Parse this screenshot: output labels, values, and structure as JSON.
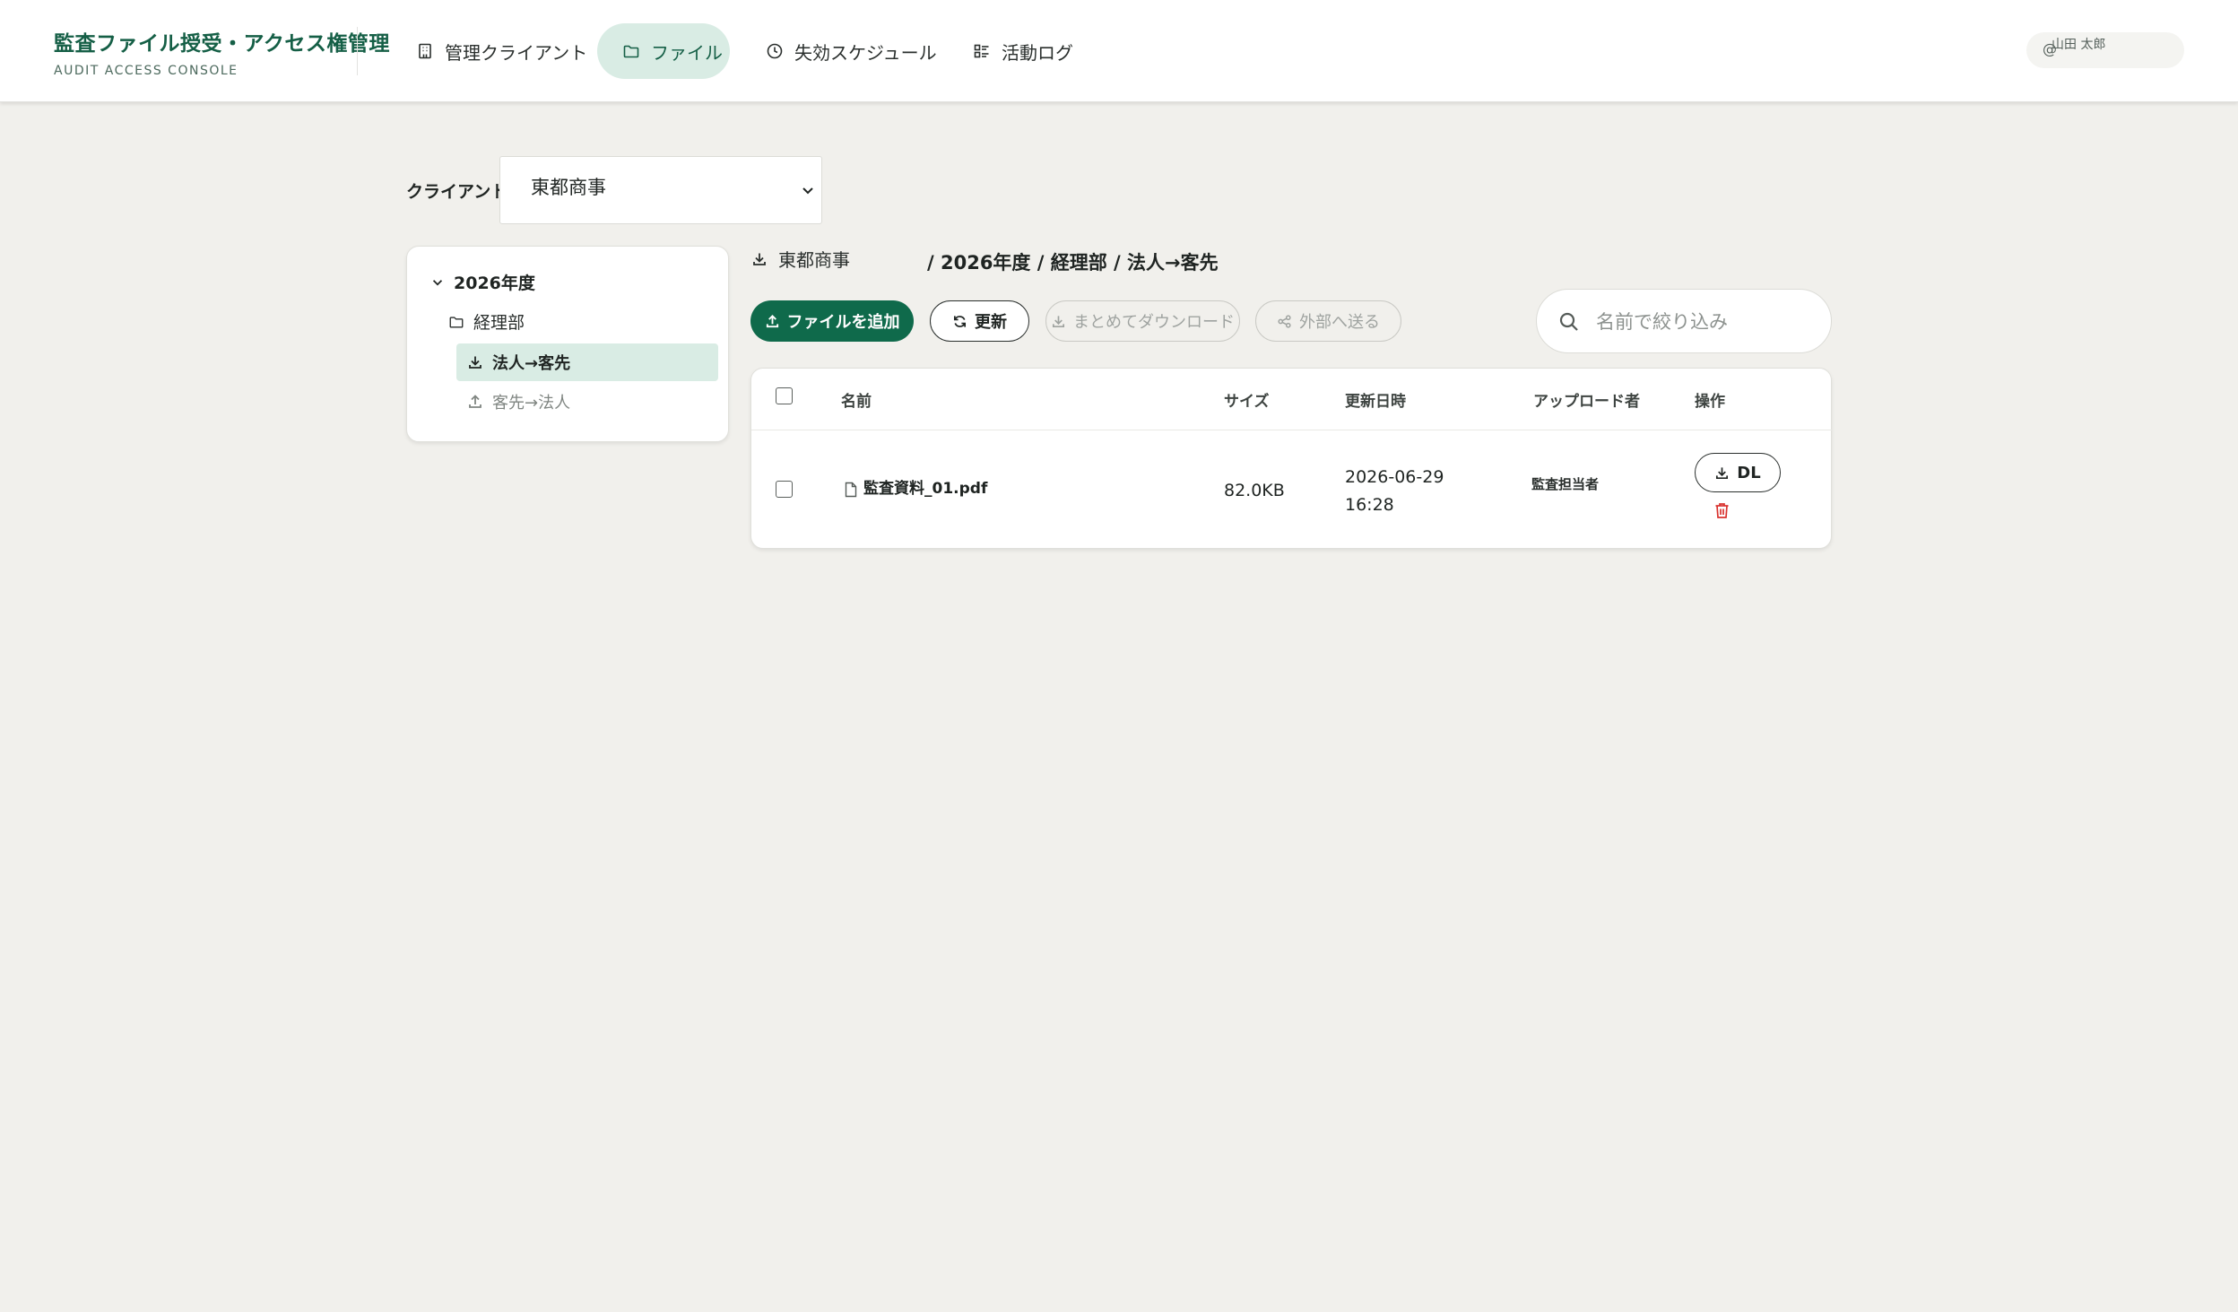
{
  "app": {
    "title": "監査ファイル授受・アクセス権管理",
    "subtitle": "AUDIT ACCESS CONSOLE"
  },
  "nav": {
    "items": [
      {
        "label": "管理クライアント",
        "icon": "building-icon",
        "active": false
      },
      {
        "label": "ファイル",
        "icon": "folder-icon",
        "active": true
      },
      {
        "label": "失効スケジュール",
        "icon": "clock-icon",
        "active": false
      },
      {
        "label": "活動ログ",
        "icon": "list-icon",
        "active": false
      }
    ]
  },
  "user": {
    "prefix": "@",
    "name": "山田 太郎"
  },
  "client": {
    "label": "クライアント",
    "selected": "東都商事"
  },
  "tree": {
    "year": "2026年度",
    "department": "経理部",
    "selected_folder": "法人→客先",
    "other_folder": "客先→法人"
  },
  "breadcrumb": {
    "client": "東都商事",
    "path": "/ 2026年度 / 経理部 / 法人→客先"
  },
  "toolbar": {
    "add_label": "ファイルを追加",
    "refresh_label": "更新",
    "bulk_download_label": "まとめてダウンロード",
    "send_external_label": "外部へ送る",
    "search_placeholder": "名前で絞り込み"
  },
  "table": {
    "columns": [
      "名前",
      "サイズ",
      "更新日時",
      "アップロード者",
      "操作"
    ],
    "rows": [
      {
        "name": "監査資料_01.pdf",
        "size": "82.0KB",
        "date": "2026-06-29",
        "time": "16:28",
        "uploader": "監査担当者",
        "download_label": "DL"
      }
    ]
  },
  "colors": {
    "brand": "#155f46",
    "primary_button": "#0f6a4b",
    "active_nav_bg": "#d9ece4",
    "background": "#f1f0ec",
    "delete": "#d9322e"
  }
}
